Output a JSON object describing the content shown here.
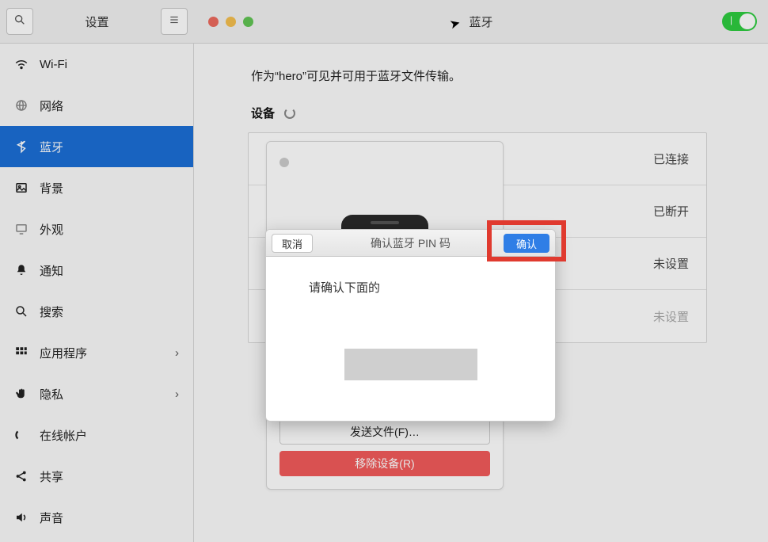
{
  "header": {
    "settings_title": "设置",
    "page_title": "蓝牙"
  },
  "sidebar": {
    "items": [
      {
        "icon": "wifi",
        "label": "Wi-Fi",
        "chevron": false
      },
      {
        "icon": "globe",
        "label": "网络",
        "chevron": false
      },
      {
        "icon": "bt",
        "label": "蓝牙",
        "chevron": false,
        "selected": true
      },
      {
        "icon": "image",
        "label": "背景",
        "chevron": false
      },
      {
        "icon": "display",
        "label": "外观",
        "chevron": false
      },
      {
        "icon": "bell",
        "label": "通知",
        "chevron": false
      },
      {
        "icon": "search",
        "label": "搜索",
        "chevron": false
      },
      {
        "icon": "grid",
        "label": "应用程序",
        "chevron": true
      },
      {
        "icon": "hand",
        "label": "隐私",
        "chevron": true
      },
      {
        "icon": "online",
        "label": "在线帐户",
        "chevron": false
      },
      {
        "icon": "share",
        "label": "共享",
        "chevron": false
      },
      {
        "icon": "sound",
        "label": "声音",
        "chevron": false
      }
    ]
  },
  "main": {
    "visibility_text": "作为“hero”可见并可用于蓝牙文件传输。",
    "devices_label": "设备",
    "device_rows": [
      {
        "status": "已连接",
        "faded": false
      },
      {
        "status": "已断开",
        "faded": false
      },
      {
        "status": "未设置",
        "faded": false
      },
      {
        "status": "未设置",
        "faded": true
      }
    ],
    "detail": {
      "send_files_label": "发送文件(F)…",
      "remove_label": "移除设备(R)"
    }
  },
  "dialog": {
    "cancel_label": "取消",
    "title": "确认蓝牙 PIN 码",
    "confirm_label": "确认",
    "body_text": "请确认下面的"
  }
}
